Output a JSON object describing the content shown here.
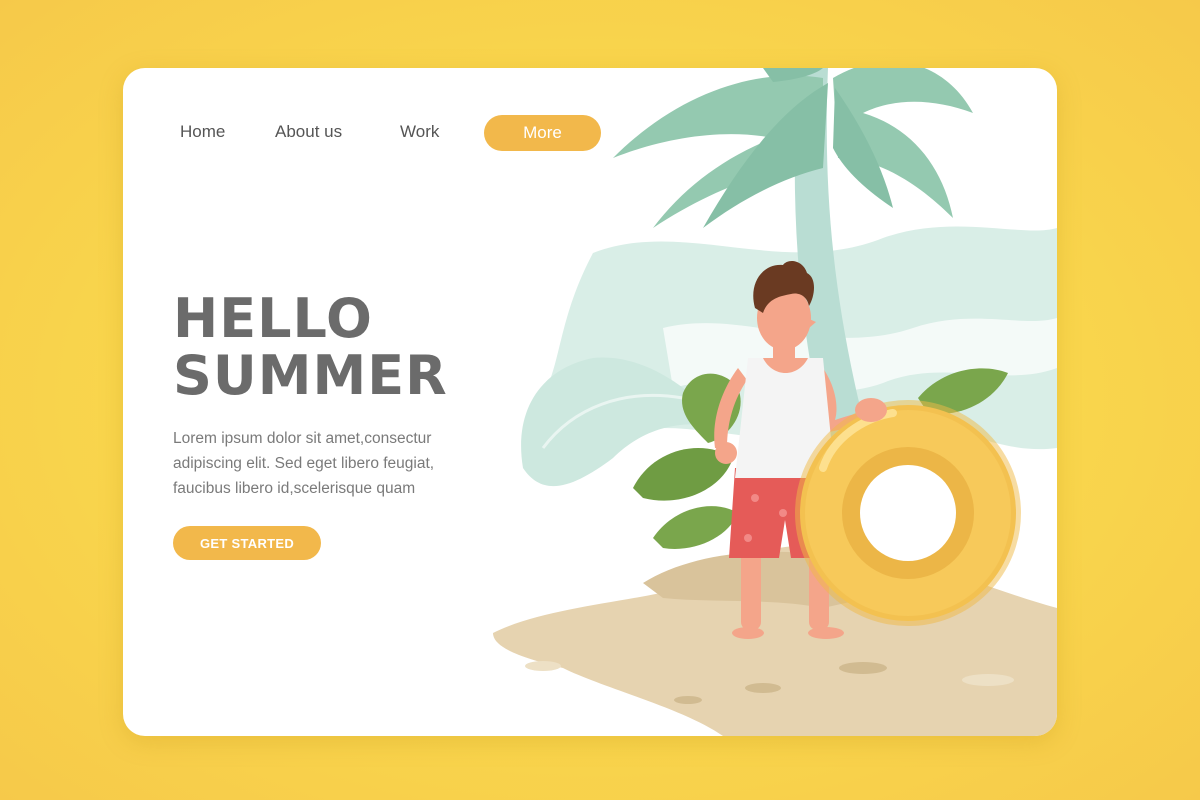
{
  "nav": {
    "home_label": "Home",
    "about_label": "About us",
    "work_label": "Work",
    "more_label": "More"
  },
  "hero": {
    "title_line1": "HELLO",
    "title_line2": "SUMMER",
    "body_lines": [
      "Lorem ipsum dolor sit amet,consectur",
      "adipiscing elit. Sed eget libero feugiat,",
      "faucibus libero id,scelerisque quam"
    ],
    "cta_label": "GET STARTED"
  },
  "colors": {
    "background": "#f9d64c",
    "accent": "#f2b84b",
    "heading": "#6b6b6b",
    "body_text": "#7a7a7a",
    "palm_leaf": "#94c9b0",
    "palm_trunk": "#b8ddd3",
    "sand": "#e6d3b0",
    "swim_ring": "#f7c95a"
  },
  "illustration": {
    "subject": "boy-with-swim-ring",
    "icons": [
      "palm-tree-icon",
      "swim-ring-icon",
      "sand-mound-icon",
      "leaf-icon"
    ]
  }
}
